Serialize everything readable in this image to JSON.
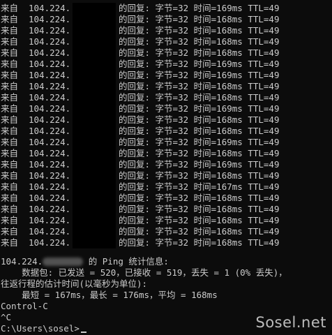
{
  "reply_prefix": "来自",
  "ip_start": "104.224.",
  "reply_lines": [
    "的回复: 字节=32 时间=169ms TTL=49",
    "的回复: 字节=32 时间=168ms TTL=49",
    "的回复: 字节=32 时间=168ms TTL=49",
    "的回复: 字节=32 时间=168ms TTL=49",
    "的回复: 字节=32 时间=168ms TTL=49",
    "的回复: 字节=32 时间=169ms TTL=49",
    "的回复: 字节=32 时间=169ms TTL=49",
    "的回复: 字节=32 时间=168ms TTL=49",
    "的回复: 字节=32 时间=168ms TTL=49",
    "的回复: 字节=32 时间=169ms TTL=49",
    "的回复: 字节=32 时间=168ms TTL=49",
    "的回复: 字节=32 时间=168ms TTL=49",
    "的回复: 字节=32 时间=169ms TTL=49",
    "的回复: 字节=32 时间=168ms TTL=49",
    "的回复: 字节=32 时间=169ms TTL=49",
    "的回复: 字节=32 时间=168ms TTL=49",
    "的回复: 字节=32 时间=167ms TTL=49",
    "的回复: 字节=32 时间=168ms TTL=49",
    "的回复: 字节=32 时间=168ms TTL=49",
    "的回复: 字节=32 时间=168ms TTL=49",
    "的回复: 字节=32 时间=168ms TTL=49",
    "的回复: 字节=32 时间=168ms TTL=49"
  ],
  "stats": {
    "ip_start": "104.224.",
    "header_suffix": " 的 Ping 统计信息:",
    "packets": "    数据包: 已发送 = 520，已接收 = 519，丢失 = 1 (0% 丢失)，",
    "rtt_header": "往返行程的估计时间(以毫秒为单位):",
    "rtt_values": "    最短 = 167ms，最长 = 176ms，平均 = 168ms"
  },
  "ctrl_c": "Control-C",
  "caret_c": "^C",
  "prompt": "C:\\Users\\sosel>",
  "watermark": "Sosel.net",
  "colors": {
    "background": "#0c0c0c",
    "text": "#cccccc"
  }
}
